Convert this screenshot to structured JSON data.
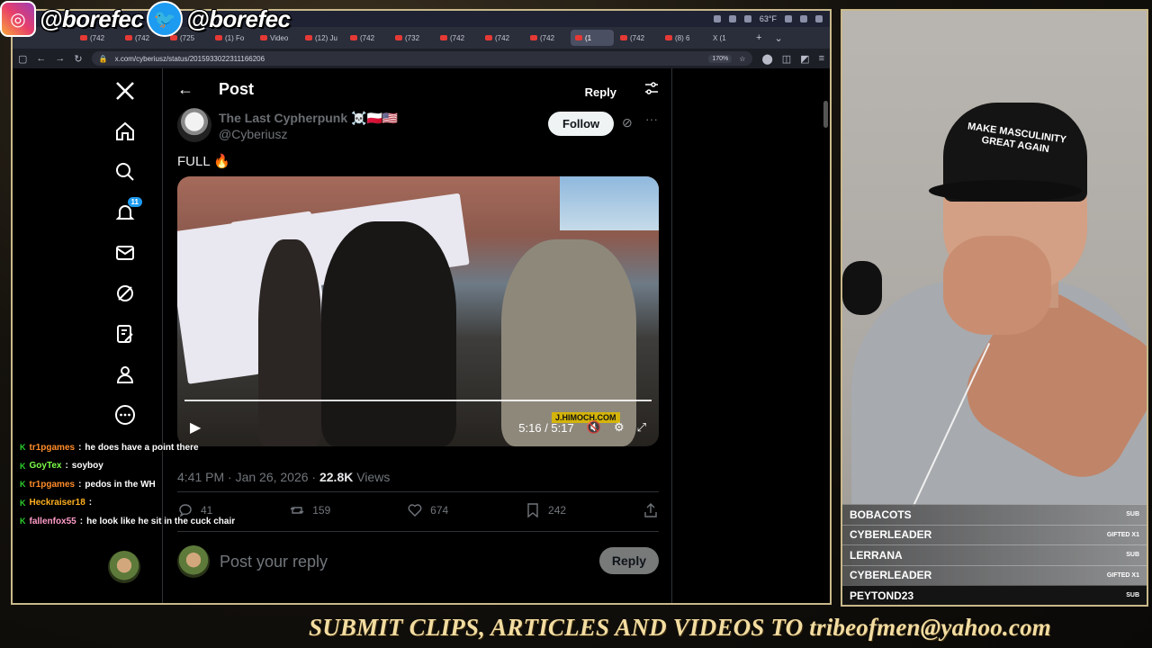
{
  "social": {
    "instagram_handle": "@borefec",
    "twitter_handle": "@borefec"
  },
  "browser": {
    "tabs": [
      "(742",
      "(742",
      "(725",
      "(1) Fo",
      "Video",
      "(12) Ju",
      "(742",
      "(732",
      "(742",
      "(742",
      "(742",
      "(1",
      "(742",
      "(8) 6",
      "X (1"
    ],
    "active_tab_index": 11,
    "url": "x.com/cyberiusz/status/2015933022311166206",
    "zoom": "170%",
    "weather": "63°F"
  },
  "nav": {
    "notifications_badge": "11"
  },
  "post": {
    "header_title": "Post",
    "reply_button": "Reply",
    "author_name": "The Last Cypherpunk ☠️🇵🇱🇺🇸",
    "author_handle": "@Cyberiusz",
    "follow_button": "Follow",
    "text": "FULL 🔥",
    "video_time": "5:16 / 5:17",
    "watermark": "J.HIMOCH.COM",
    "timestamp": "4:41 PM · Jan 26, 2026 · ",
    "views_count": "22.8K",
    "views_label": " Views",
    "replies": "41",
    "reposts": "159",
    "likes": "674",
    "bookmarks": "242",
    "compose_placeholder": "Post your reply",
    "compose_button": "Reply"
  },
  "chat": [
    {
      "user": "tr1pgames",
      "text": "he does have a point there",
      "color": "#ff8c2a"
    },
    {
      "user": "GoyTex",
      "text": "soyboy",
      "color": "#7cff4a"
    },
    {
      "user": "tr1pgames",
      "text": "pedos in the WH",
      "color": "#ff8c2a"
    },
    {
      "user": "Heckraiser18",
      "text": "",
      "color": "#ffb020"
    },
    {
      "user": "fallenfox55",
      "text": "he look like he sit in the cuck chair",
      "color": "#ff9cc8"
    }
  ],
  "webcam": {
    "hat_text": "MAKE MASCULINITY GREAT AGAIN",
    "subs": [
      {
        "name": "BOBACOTS",
        "tag": "SUB"
      },
      {
        "name": "CYBERLEADER",
        "tag": "GIFTED X1"
      },
      {
        "name": "LERRANA",
        "tag": "SUB"
      },
      {
        "name": "CYBERLEADER",
        "tag": "GIFTED X1"
      },
      {
        "name": "PEYTOND23",
        "tag": "SUB"
      }
    ]
  },
  "banner": "SUBMIT CLIPS, ARTICLES AND VIDEOS TO tribeofmen@yahoo.com"
}
